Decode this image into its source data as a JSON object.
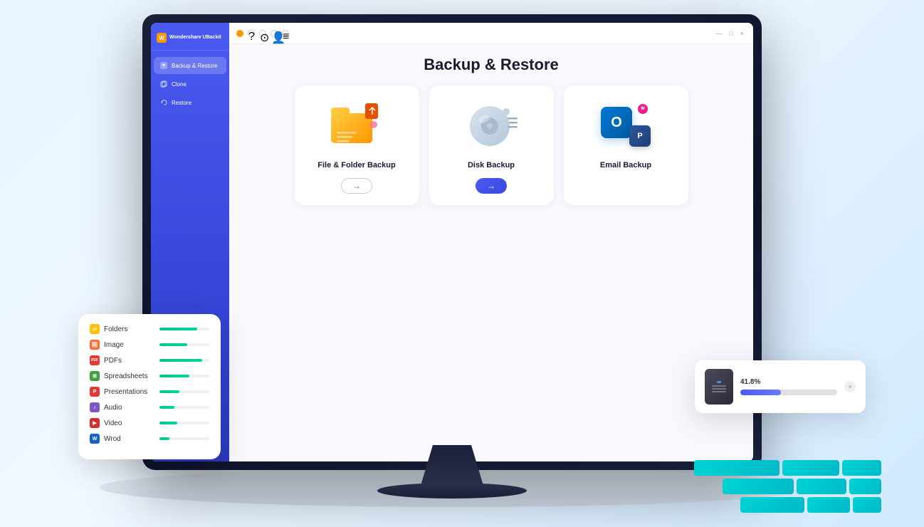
{
  "app": {
    "name": "Wondershare UBackit",
    "logo_char": "W"
  },
  "window": {
    "controls": [
      "—",
      "□",
      "×"
    ],
    "toolbar_icons": [
      "🔔",
      "?",
      "⊙",
      "👤",
      "☰"
    ]
  },
  "sidebar": {
    "items": [
      {
        "id": "backup-restore",
        "label": "Backup & Restore",
        "active": true
      },
      {
        "id": "clone",
        "label": "Clone",
        "active": false
      },
      {
        "id": "restore",
        "label": "Restore",
        "active": false
      }
    ]
  },
  "main": {
    "title": "Backup & Restore",
    "cards": [
      {
        "id": "file-folder",
        "label": "File & Folder Backup",
        "btn_type": "outline",
        "btn_arrow": "→"
      },
      {
        "id": "disk",
        "label": "Disk Backup",
        "btn_type": "primary",
        "btn_arrow": "→"
      },
      {
        "id": "email",
        "label": "Email Backup",
        "btn_type": "none"
      }
    ]
  },
  "file_types_panel": {
    "items": [
      {
        "id": "folders",
        "name": "Folders",
        "color": "#ffc107",
        "progress": 75
      },
      {
        "id": "image",
        "name": "Image",
        "color": "#ff6b35",
        "progress": 55
      },
      {
        "id": "pdfs",
        "name": "PDFs",
        "color": "#e53935",
        "progress": 85
      },
      {
        "id": "spreadsheets",
        "name": "Spreadsheets",
        "color": "#43a047",
        "progress": 60
      },
      {
        "id": "presentations",
        "name": "Presentations",
        "color": "#e53935",
        "progress": 40
      },
      {
        "id": "audio",
        "name": "Audio",
        "color": "#7e57c2",
        "progress": 30
      },
      {
        "id": "video",
        "name": "Video",
        "color": "#d32f2f",
        "progress": 35
      },
      {
        "id": "word",
        "name": "Wrod",
        "color": "#1565c0",
        "progress": 20
      }
    ]
  },
  "progress_panel": {
    "percent": "41.8%",
    "progress_value": 41.8,
    "close_label": "×"
  },
  "teal_blocks": [
    [
      120,
      80,
      60
    ],
    [
      100,
      70,
      50
    ],
    [
      90,
      60,
      40
    ]
  ]
}
